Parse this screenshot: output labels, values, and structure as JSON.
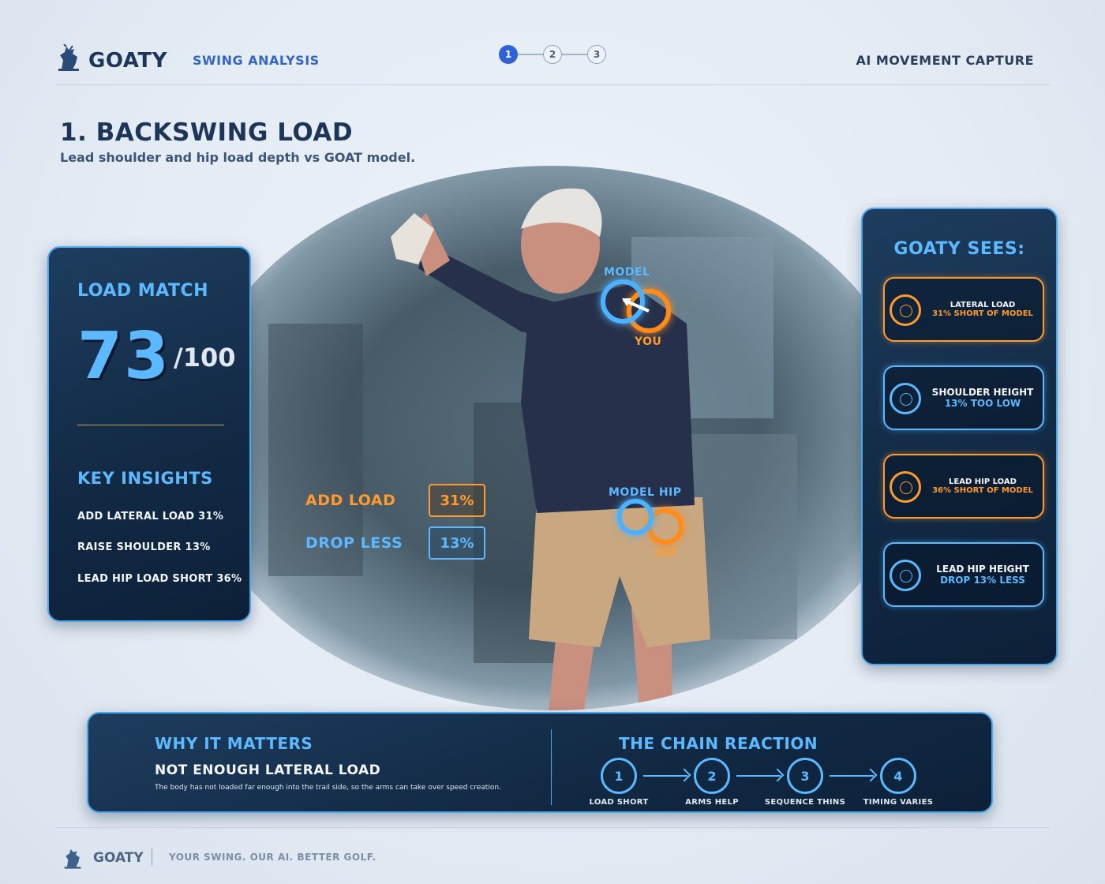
{
  "header": {
    "brand": "GOATY",
    "section_tab": "SWING ANALYSIS",
    "steps": [
      "1",
      "2",
      "3"
    ],
    "active_step": 1,
    "capture_label": "AI MOVEMENT CAPTURE"
  },
  "page": {
    "title": "1. BACKSWING LOAD",
    "subtitle": "Lead shoulder and hip load depth vs GOAT model."
  },
  "overlay": {
    "shoulder_model": "MODEL",
    "shoulder_you": "YOU",
    "hip_model": "MODEL HIP",
    "hip_you": "HIP",
    "metrics": [
      {
        "label": "ADD LOAD",
        "value": "31%",
        "tone": "orange"
      },
      {
        "label": "DROP LESS",
        "value": "13%",
        "tone": "blue"
      }
    ]
  },
  "load_match": {
    "title": "LOAD MATCH",
    "score": "73",
    "max": "/100",
    "insights_title": "KEY INSIGHTS",
    "insights": [
      "ADD LATERAL LOAD 31%",
      "RAISE SHOULDER 13%",
      "LEAD HIP LOAD SHORT 36%"
    ]
  },
  "goaty_sees": {
    "title": "GOATY SEES:",
    "items": [
      {
        "main": "LATERAL LOAD",
        "sub": "31% SHORT OF MODEL",
        "tone": "orange",
        "size": "small"
      },
      {
        "main": "SHOULDER HEIGHT",
        "sub": "13% TOO LOW",
        "tone": "blue",
        "size": "big"
      },
      {
        "main": "LEAD HIP LOAD",
        "sub": "36% SHORT OF MODEL",
        "tone": "orange",
        "size": "small"
      },
      {
        "main": "LEAD HIP HEIGHT",
        "sub": "DROP 13% LESS",
        "tone": "blue",
        "size": "big"
      }
    ]
  },
  "why": {
    "title": "WHY IT MATTERS",
    "headline": "NOT ENOUGH LATERAL LOAD",
    "body": "The body has not loaded far enough into the trail side, so the arms can take over speed creation."
  },
  "chain": {
    "title": "THE CHAIN REACTION",
    "steps": [
      {
        "num": "1",
        "label": "LOAD SHORT"
      },
      {
        "num": "2",
        "label": "ARMS HELP"
      },
      {
        "num": "3",
        "label": "SEQUENCE THINS"
      },
      {
        "num": "4",
        "label": "TIMING VARIES"
      }
    ]
  },
  "footer": {
    "brand": "GOATY",
    "tagline": "YOUR SWING. OUR AI. BETTER GOLF."
  },
  "colors": {
    "accent_blue": "#5cb8ff",
    "accent_orange": "#ff9a2e",
    "navy": "#1d3557",
    "step_active": "#2f62d6"
  }
}
